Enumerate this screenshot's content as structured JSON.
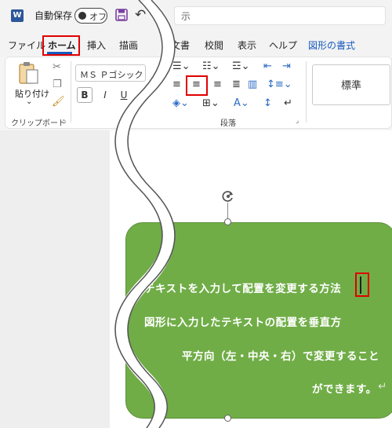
{
  "titlebar": {
    "app_icon": "word-logo-icon",
    "autosave_label": "自動保存",
    "autosave_state": "オフ",
    "title_fragment": "示"
  },
  "tabs": [
    {
      "label": "ファイル"
    },
    {
      "label": "ホーム",
      "active": true
    },
    {
      "label": "挿入"
    },
    {
      "label": "描画"
    },
    {
      "label": "文書"
    },
    {
      "label": "校閲"
    },
    {
      "label": "表示"
    },
    {
      "label": "ヘルプ"
    },
    {
      "label": "図形の書式"
    }
  ],
  "ribbon": {
    "clipboard": {
      "paste_label": "貼り付け",
      "group_label": "クリップボード"
    },
    "font": {
      "font_name": "ＭＳ Ｐゴシック",
      "bold": "B",
      "italic": "I",
      "underline": "U"
    },
    "paragraph": {
      "group_label": "段落"
    },
    "styles": {
      "normal_label": "標準"
    }
  },
  "document": {
    "shape_lines": [
      "テキストを入力して配置を変更する方法",
      "図形に入力したテキストの配置を垂直方",
      "平方向（左・中央・右）で変更すること",
      "ができます。"
    ],
    "paragraph_mark": "↵"
  },
  "colors": {
    "highlight": "#e00000",
    "shape_fill": "#70ad47",
    "accent": "#185abd"
  }
}
